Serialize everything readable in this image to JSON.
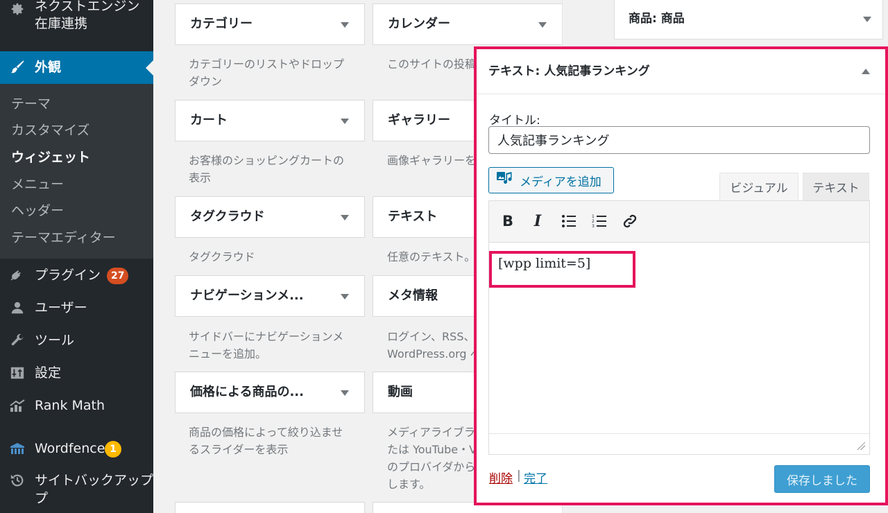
{
  "colors": {
    "sidebar_bg": "#23282d",
    "sidebar_active": "#0073aa",
    "highlight": "#e5145c",
    "plugin_badge": "#d54e21",
    "wordfence_badge": "#ffb900"
  },
  "sidebar": {
    "top_item": {
      "label": "ネクストエンジン\n在庫連携",
      "icon": "gear-icon"
    },
    "active_item": {
      "label": "外観",
      "icon": "paintbrush-icon"
    },
    "submenu": [
      {
        "label": "テーマ"
      },
      {
        "label": "カスタマイズ"
      },
      {
        "label": "ウィジェット"
      },
      {
        "label": "メニュー"
      },
      {
        "label": "ヘッダー"
      },
      {
        "label": "テーマエディター"
      }
    ],
    "items": [
      {
        "label": "プラグイン",
        "icon": "plugin-icon",
        "badge": "27"
      },
      {
        "label": "ユーザー",
        "icon": "user-icon"
      },
      {
        "label": "ツール",
        "icon": "wrench-icon"
      },
      {
        "label": "設定",
        "icon": "settings-icon"
      },
      {
        "label": "Rank Math",
        "icon": "rank-math-icon"
      },
      {
        "label": "Wordfence",
        "icon": "wordfence-icon",
        "badge": "1"
      },
      {
        "label": "サイトバックアップ\nプ",
        "icon": "history-icon"
      }
    ]
  },
  "widgets": {
    "left_column": [
      {
        "title": "カテゴリー",
        "desc": "カテゴリーのリストやドロップ\nダウン"
      },
      {
        "title": "カート",
        "desc": "お客様のショッピングカートの\n表示"
      },
      {
        "title": "タグクラウド",
        "desc": "タグクラウド"
      },
      {
        "title": "ナビゲーションメ...",
        "desc": "サイドバーにナビゲーションメ\nニューを追加。"
      },
      {
        "title": "価格による商品の...",
        "desc": "商品の価格によって絞り込ませ\nるスライダーを表示"
      }
    ],
    "right_column": [
      {
        "title": "カレンダー",
        "desc": "このサイトの投稿"
      },
      {
        "title": "ギャラリー",
        "desc": "画像ギャラリーを"
      },
      {
        "title": "テキスト",
        "desc": "任意のテキスト。"
      },
      {
        "title": "メタ情報",
        "desc": "ログイン、RSS、\nWordPress.org へ"
      },
      {
        "title": "動画",
        "desc": "メディアライブラ\nたは YouTube・V\nのプロバイダから\nします。"
      }
    ]
  },
  "sidebar_area": {
    "product_widget": {
      "title_bold": "商品",
      "title_rest": ": 商品"
    }
  },
  "text_widget": {
    "header_bold": "テキスト",
    "header_rest": ": 人気記事ランキング",
    "title_label": "タイトル:",
    "title_value": "人気記事ランキング",
    "add_media_label": "メディアを追加",
    "tab_visual": "ビジュアル",
    "tab_text": "テキスト",
    "content": "[wpp limit=5]",
    "delete_label": "削除",
    "separator": "|",
    "done_label": "完了",
    "save_label": "保存しました"
  }
}
